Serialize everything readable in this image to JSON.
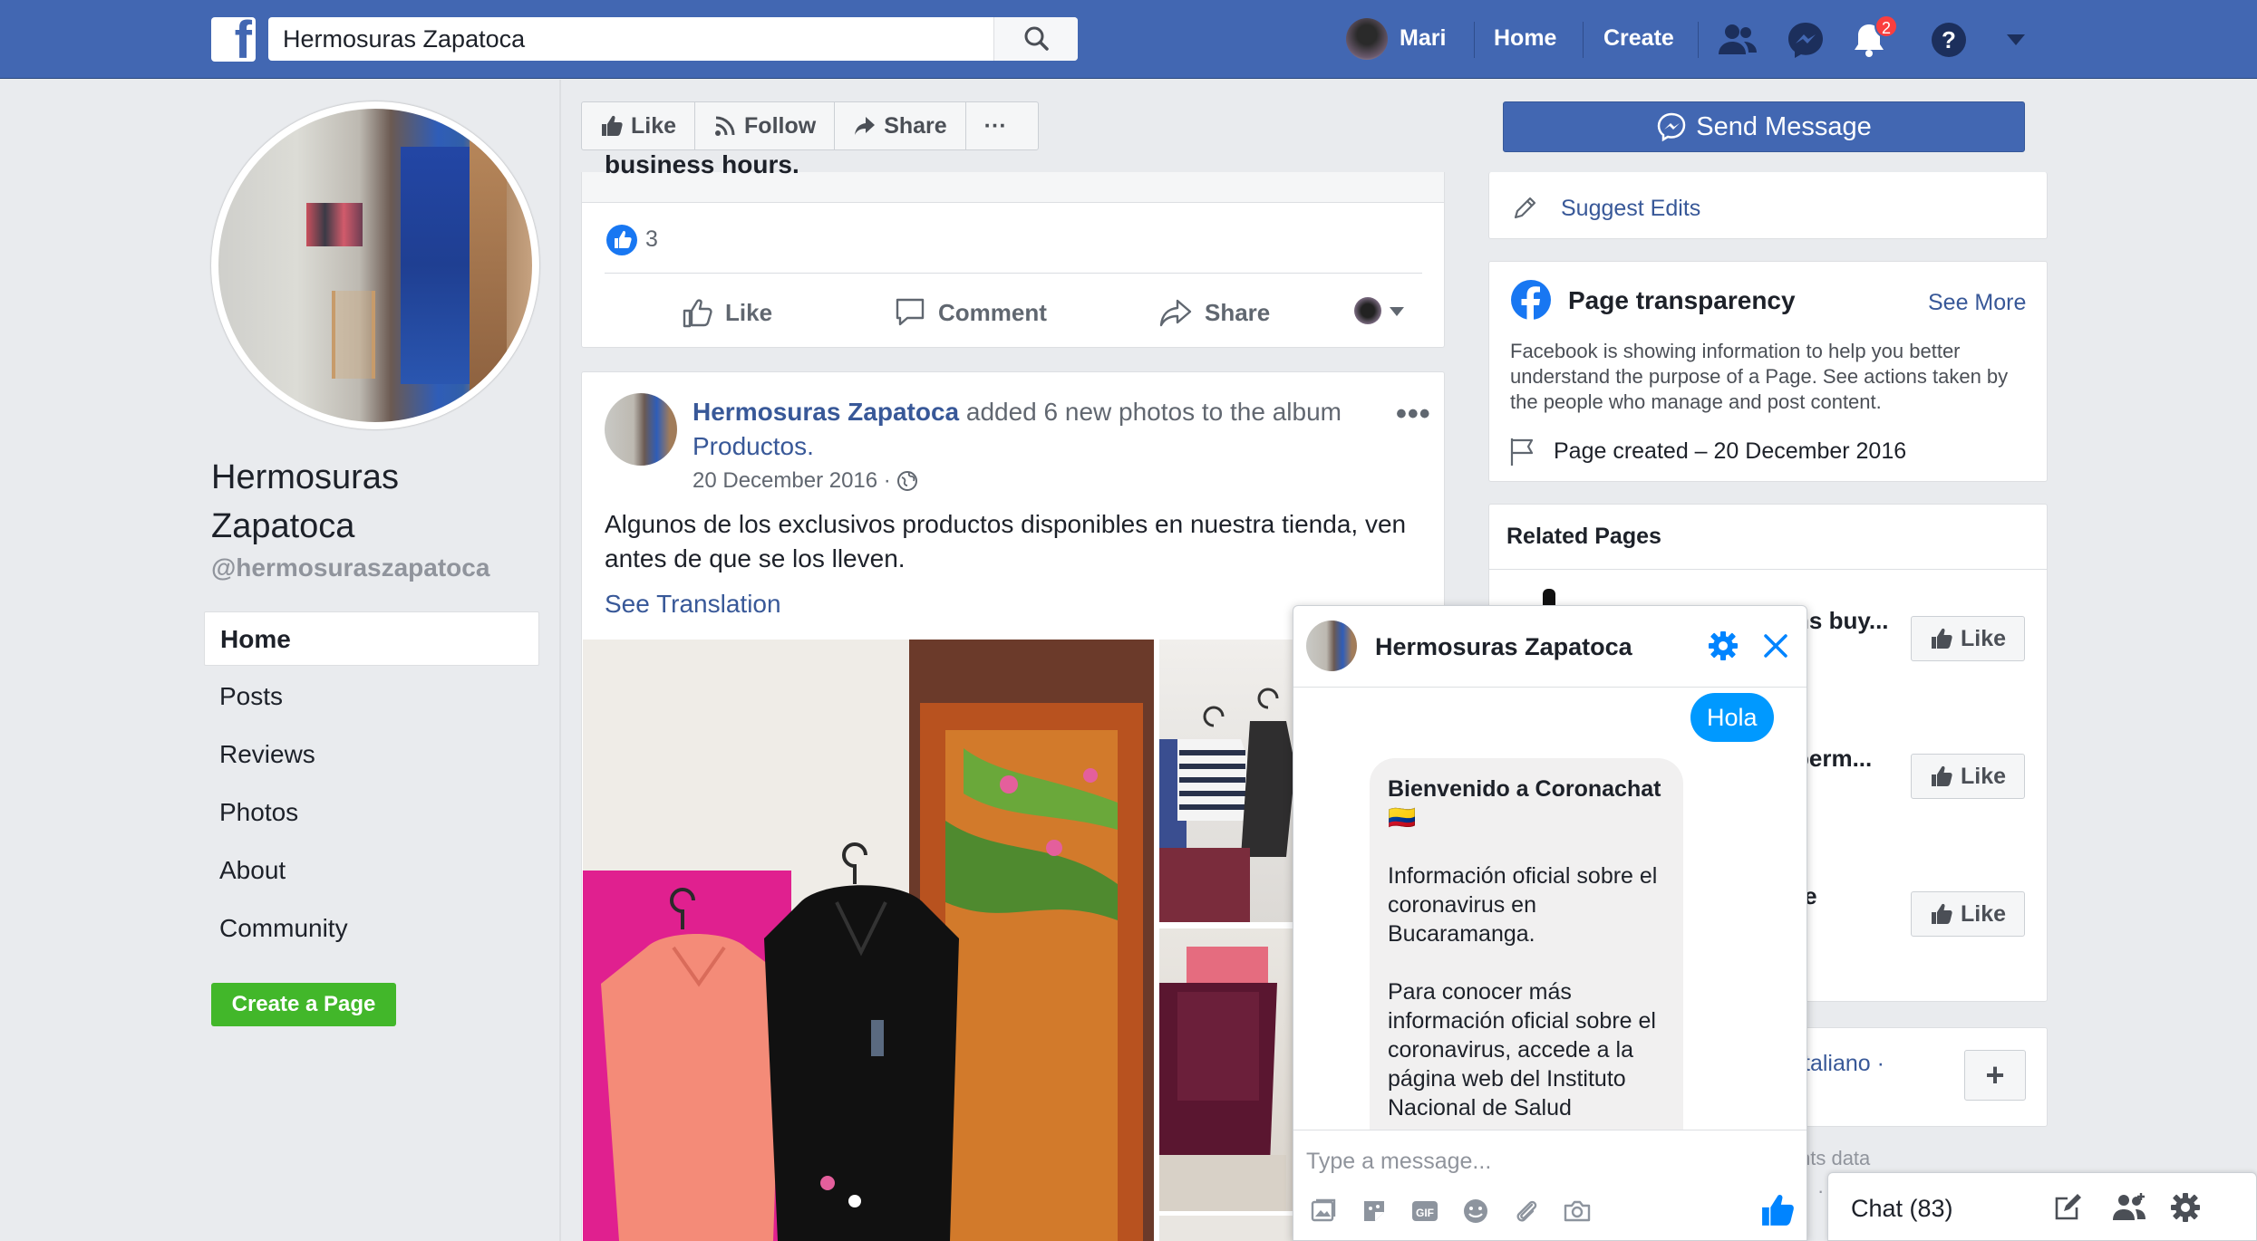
{
  "topbar": {
    "search_value": "Hermosuras Zapatoca",
    "user_name": "Mari",
    "home_label": "Home",
    "create_label": "Create",
    "notification_count": "2",
    "accent_color": "#4267b2"
  },
  "left": {
    "page_name": "Hermosuras Zapatoca",
    "page_handle": "@hermosuraszapatoca",
    "nav": [
      "Home",
      "Posts",
      "Reviews",
      "Photos",
      "About",
      "Community"
    ],
    "create_page_label": "Create a Page"
  },
  "actions": {
    "like": "Like",
    "follow": "Follow",
    "share": "Share",
    "more": "···",
    "send_message": "Send Message"
  },
  "post1": {
    "cut_text": "business hours.",
    "like_count": "3",
    "like_label": "Like",
    "comment_label": "Comment",
    "share_label": "Share"
  },
  "post2": {
    "author": "Hermosuras Zapatoca",
    "action_text": " added 6 new photos to the album ",
    "album": "Productos.",
    "date": "20 December 2016 ·",
    "more": "•••",
    "text": "Algunos de los exclusivos productos disponibles en nuestra tienda, ven antes de que se los lleven.",
    "see_translation": "See Translation"
  },
  "right": {
    "suggest_edits": "Suggest Edits",
    "transparency_title": "Page transparency",
    "see_more": "See More",
    "transparency_text": "Facebook is showing information to help you better understand the purpose of a Page. See actions taken by the people who manage and post content.",
    "page_created": "Page created – 20 December 2016",
    "related_title": "Related Pages",
    "related": [
      {
        "name": "ns buy...",
        "like": "Like"
      },
      {
        "name": "perm...",
        "like": "Like"
      },
      {
        "name": "re",
        "like": "Like"
      }
    ],
    "language_link": "taliano ·",
    "plus": "+",
    "footer1": "nts data",
    "footer2": "· A"
  },
  "chat": {
    "title": "Hermosuras Zapatoca",
    "outgoing": "Hola",
    "bot_title": "Bienvenido a Coronachat 🇨🇴",
    "bot_p1": "Información oficial sobre el coronavirus en Bucaramanga.",
    "bot_p2": "Para conocer más información oficial sobre el coronavirus, accede a la página web del Instituto Nacional de Salud",
    "input_placeholder": "Type a message...",
    "bubble_color": "#0099ff"
  },
  "chatbar": {
    "label": "Chat (83)"
  }
}
